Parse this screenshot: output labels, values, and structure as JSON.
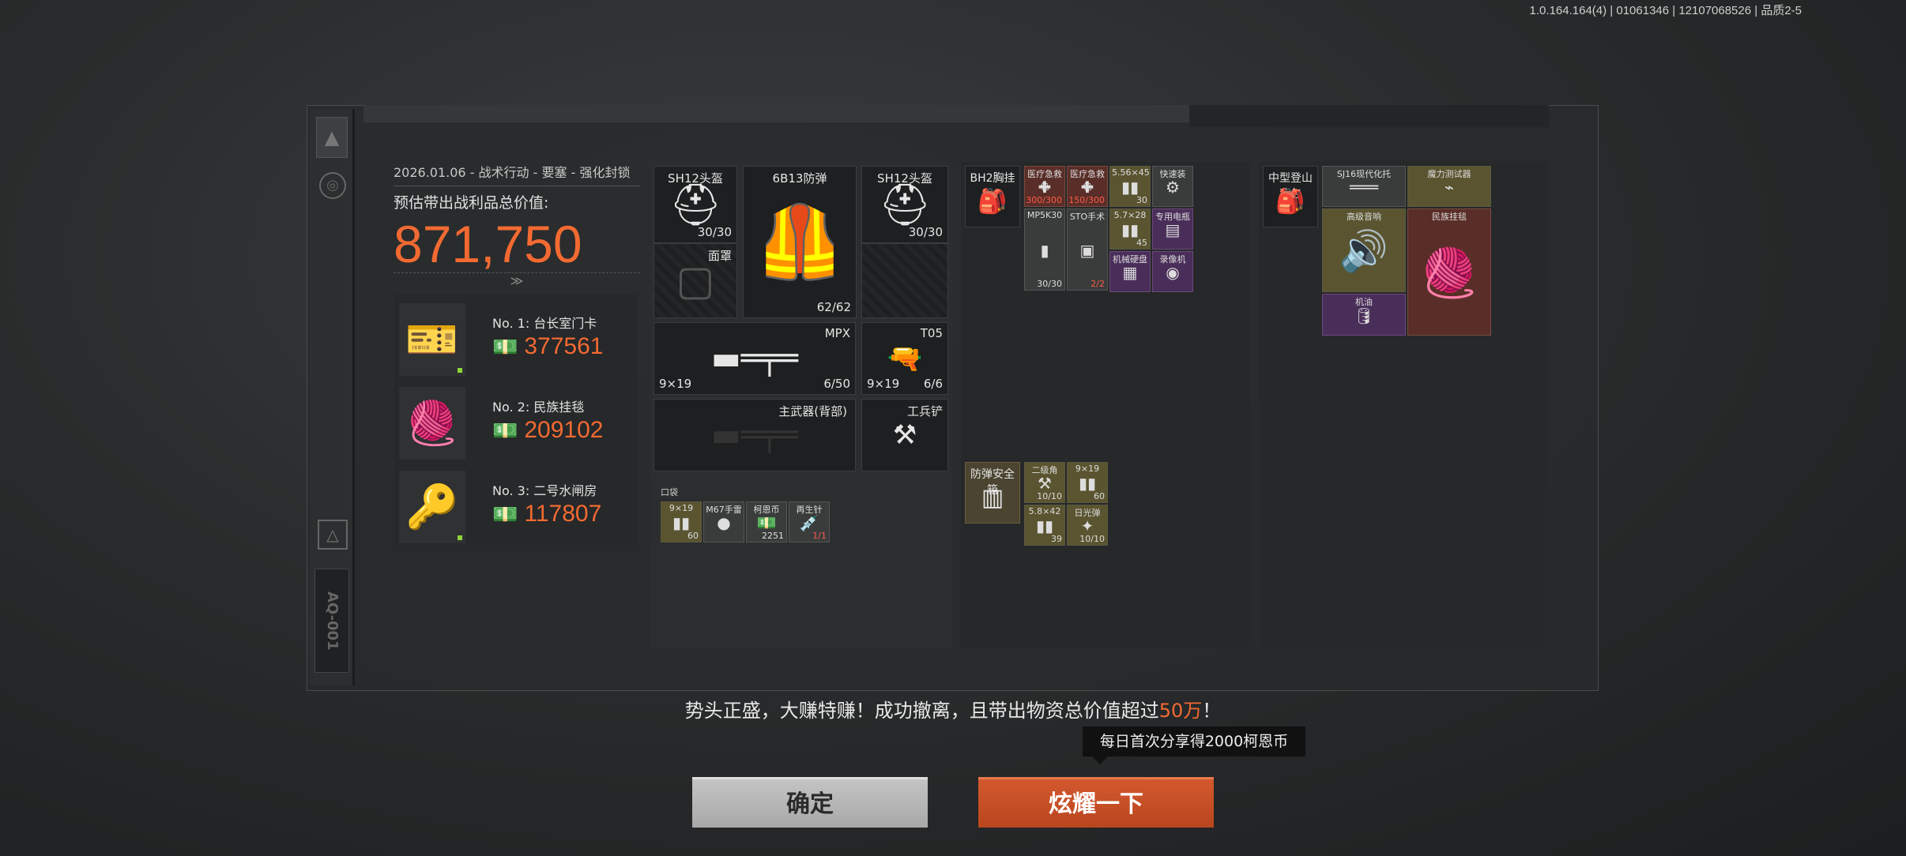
{
  "version": "1.0.164.164(4) | 01061346 | 12107068526 | 品质2-5",
  "rail": {
    "code": "AQ-001"
  },
  "summary": {
    "operation": "2026.01.06 - 战术行动 - 要塞 - 强化封锁",
    "value_label": "预估带出战利品总价值:",
    "total_value": "871,750",
    "chevron": "≫"
  },
  "top_items": [
    {
      "rank": "No. 1: 台长室门卡",
      "value": "377561",
      "icon": "card-icon",
      "glyph": "🎫"
    },
    {
      "rank": "No. 2: 民族挂毯",
      "value": "209102",
      "icon": "rug-icon",
      "glyph": "🧶"
    },
    {
      "rank": "No. 3: 二号水闸房",
      "value": "117807",
      "icon": "key-icon",
      "glyph": "🔑"
    }
  ],
  "equipment": {
    "helmet1": {
      "label": "SH12头盔",
      "count": "30/30"
    },
    "armor": {
      "label": "6B13防弹",
      "count": "62/62"
    },
    "helmet2": {
      "label": "SH12头盔",
      "count": "30/30"
    },
    "mask": {
      "label": "面罩"
    },
    "primary": {
      "label": "MPX",
      "caliber": "9×19",
      "count": "6/50"
    },
    "pistol": {
      "label": "T05",
      "caliber": "9×19",
      "count": "6/6"
    },
    "back_weapon": {
      "label": "主武器(背部)"
    },
    "melee": {
      "label": "工兵铲"
    },
    "pocket_label": "口袋",
    "pockets": [
      {
        "label": "9×19",
        "count": "60"
      },
      {
        "label": "M67手雷",
        "count": ""
      },
      {
        "label": "柯恩币",
        "count": "2251"
      },
      {
        "label": "再生针",
        "count": "1/1"
      }
    ]
  },
  "rig": {
    "name": "BH2胸挂",
    "cells": [
      {
        "label": "医疗急救包",
        "count": "300/300"
      },
      {
        "label": "医疗急救包",
        "count": "150/300"
      },
      {
        "label": "5.56×45",
        "count": "30"
      },
      {
        "label": "快速装",
        "count": ""
      },
      {
        "label": "MP5K30",
        "count": "30/30"
      },
      {
        "label": "STO手术",
        "count": "2/2"
      },
      {
        "label": "5.7×28",
        "count": "45"
      },
      {
        "label": "专用电瓶",
        "count": ""
      },
      {
        "label": "机械硬盘",
        "count": ""
      },
      {
        "label": "录像机",
        "count": ""
      }
    ],
    "safe_box": "防弹安全箱",
    "safe_cells": [
      {
        "label": "二级角",
        "count": "10/10"
      },
      {
        "label": "9×19",
        "count": "60"
      },
      {
        "label": "5.8×42",
        "count": "39"
      },
      {
        "label": "日光弹",
        "count": "10/10"
      }
    ]
  },
  "backpack": {
    "name": "中型登山背包",
    "cells": [
      {
        "label": "SJ16现代化托",
        "count": ""
      },
      {
        "label": "魔力测试器",
        "count": ""
      },
      {
        "label": "高级音响",
        "count": ""
      },
      {
        "label": "民族挂毯",
        "count": ""
      },
      {
        "label": "机油",
        "count": ""
      }
    ]
  },
  "footer": {
    "message_prefix": "势头正盛，大赚特赚！成功撤离，且带出物资总价值超过",
    "message_highlight": "50万",
    "message_suffix": "！",
    "tooltip": "每日首次分享得2000柯恩币",
    "ok_label": "确定",
    "share_label": "炫耀一下"
  }
}
